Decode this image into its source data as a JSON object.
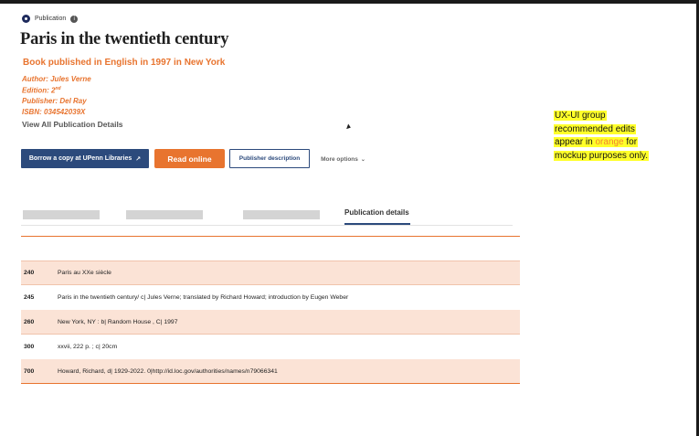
{
  "record": {
    "badge": "Publication",
    "title": "Paris in the twentieth century",
    "subtitle": "Book published in English in 1997 in New York",
    "author": "Author: Jules Verne",
    "edition_prefix": "Edition: 2",
    "edition_sup": "nd",
    "publisher": "Publisher: Del Ray",
    "isbn": "ISBN: 034542039X",
    "view_all": "View All Publication Details"
  },
  "actions": {
    "borrow": "Borrow a copy at UPenn Libraries",
    "read_online": "Read online",
    "publisher_description": "Publisher description",
    "more_options": "More options"
  },
  "tabs": {
    "active": "Publication details"
  },
  "marc_rows": [
    {
      "tag": "240",
      "value": "Paris au XXe siècle"
    },
    {
      "tag": "245",
      "value": "Paris in the twentieth century/ c| Jules Verne; translated by Richard Howard; introduction by Eugen Weber"
    },
    {
      "tag": "260",
      "value": "New York, NY : b| Random House , C| 1997"
    },
    {
      "tag": "300",
      "value": "xxvii, 222 p. ; c| 20cm"
    },
    {
      "tag": "700",
      "value": " Howard, Richard, d| 1929-2022. 0|http://id.loc.gov/authorities/names/n79066341"
    }
  ],
  "note": {
    "line1": "UX-UI group",
    "line2": "recommended edits",
    "line3_prefix": "appear in ",
    "line3_orange": "orange",
    "line3_suffix": " for",
    "line4": "mockup purposes only."
  },
  "colors": {
    "accent_orange": "#e8742f",
    "primary_navy": "#2c4a7c",
    "highlight_yellow": "#ffff2a",
    "row_shade": "#fbe3d6"
  }
}
